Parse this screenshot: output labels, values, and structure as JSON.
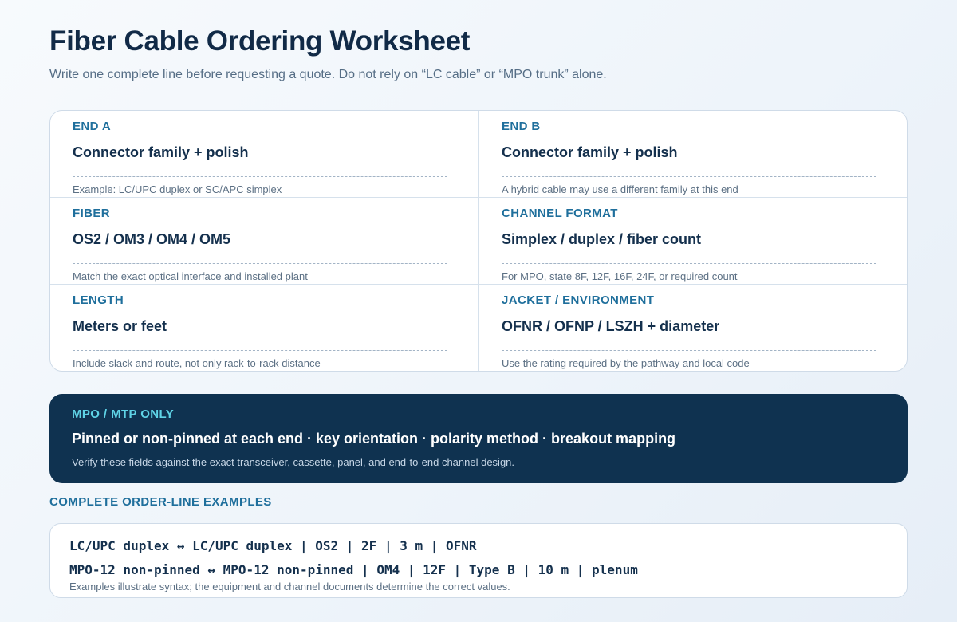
{
  "header": {
    "title": "Fiber Cable Ordering Worksheet",
    "subtitle": "Write one complete line before requesting a quote. Do not rely on “LC cable” or “MPO trunk” alone."
  },
  "fields": [
    {
      "label": "END A",
      "value": "Connector family + polish",
      "hint": "Example: LC/UPC duplex or SC/APC simplex"
    },
    {
      "label": "END B",
      "value": "Connector family + polish",
      "hint": "A hybrid cable may use a different family at this end"
    },
    {
      "label": "FIBER",
      "value": "OS2 / OM3 / OM4 / OM5",
      "hint": "Match the exact optical interface and installed plant"
    },
    {
      "label": "CHANNEL FORMAT",
      "value": "Simplex / duplex / fiber count",
      "hint": "For MPO, state 8F, 12F, 16F, 24F, or required count"
    },
    {
      "label": "LENGTH",
      "value": "Meters or feet",
      "hint": "Include slack and route, not only rack-to-rack distance"
    },
    {
      "label": "JACKET / ENVIRONMENT",
      "value": "OFNR / OFNP / LSZH + diameter",
      "hint": "Use the rating required by the pathway and local code"
    }
  ],
  "mpo": {
    "label": "MPO / MTP ONLY",
    "value": "Pinned or non-pinned at each end · key orientation · polarity method · breakout mapping",
    "hint": "Verify these fields against the exact transceiver, cassette, panel, and end-to-end channel design."
  },
  "examples": {
    "heading": "COMPLETE ORDER-LINE EXAMPLES",
    "lines": [
      "LC/UPC duplex ↔ LC/UPC duplex | OS2 | 2F | 3 m | OFNR",
      "MPO-12 non-pinned ↔ MPO-12 non-pinned | OM4 | 12F | Type B | 10 m | plenum"
    ],
    "note": "Examples illustrate syntax; the equipment and channel documents determine the correct values."
  },
  "colors": {
    "accent": "#1f6f9c",
    "heading": "#112a47",
    "mpo_background": "#0f3250",
    "mpo_accent": "#5fd3e6"
  }
}
